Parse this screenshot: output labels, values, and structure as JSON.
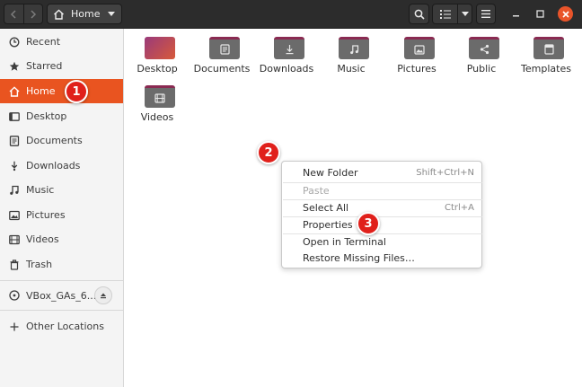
{
  "headerbar": {
    "path_label": "Home",
    "nav_back_icon": "chevron-left-icon",
    "nav_forward_icon": "chevron-right-icon"
  },
  "sidebar": {
    "items": [
      {
        "label": "Recent",
        "icon": "clock-icon"
      },
      {
        "label": "Starred",
        "icon": "star-icon"
      },
      {
        "label": "Home",
        "icon": "home-icon",
        "active": true
      },
      {
        "label": "Desktop",
        "icon": "desktop-icon"
      },
      {
        "label": "Documents",
        "icon": "document-icon"
      },
      {
        "label": "Downloads",
        "icon": "download-icon"
      },
      {
        "label": "Music",
        "icon": "music-icon"
      },
      {
        "label": "Pictures",
        "icon": "picture-icon"
      },
      {
        "label": "Videos",
        "icon": "video-icon"
      },
      {
        "label": "Trash",
        "icon": "trash-icon"
      }
    ],
    "device": {
      "label": "VBox_GAs_6....",
      "icon": "disc-icon"
    },
    "other": {
      "label": "Other Locations",
      "icon": "plus-icon"
    }
  },
  "files": [
    {
      "label": "Desktop"
    },
    {
      "label": "Documents"
    },
    {
      "label": "Downloads"
    },
    {
      "label": "Music"
    },
    {
      "label": "Pictures"
    },
    {
      "label": "Public"
    },
    {
      "label": "Templates"
    },
    {
      "label": "Videos"
    }
  ],
  "context_menu": {
    "items": [
      {
        "label": "New Folder",
        "accel": "Shift+Ctrl+N"
      },
      {
        "label": "Paste",
        "accel": "",
        "disabled": true
      },
      {
        "label": "Select All",
        "accel": "Ctrl+A"
      },
      {
        "label": "Properties",
        "accel": ""
      },
      {
        "label": "Open in Terminal",
        "accel": ""
      },
      {
        "label": "Restore Missing Files…",
        "accel": ""
      }
    ]
  },
  "badges": [
    "1",
    "2",
    "3"
  ],
  "colors": {
    "accent": "#e95420",
    "badge": "#e0201b",
    "headerbar": "#2c2c2c",
    "close": "#e9542a"
  }
}
